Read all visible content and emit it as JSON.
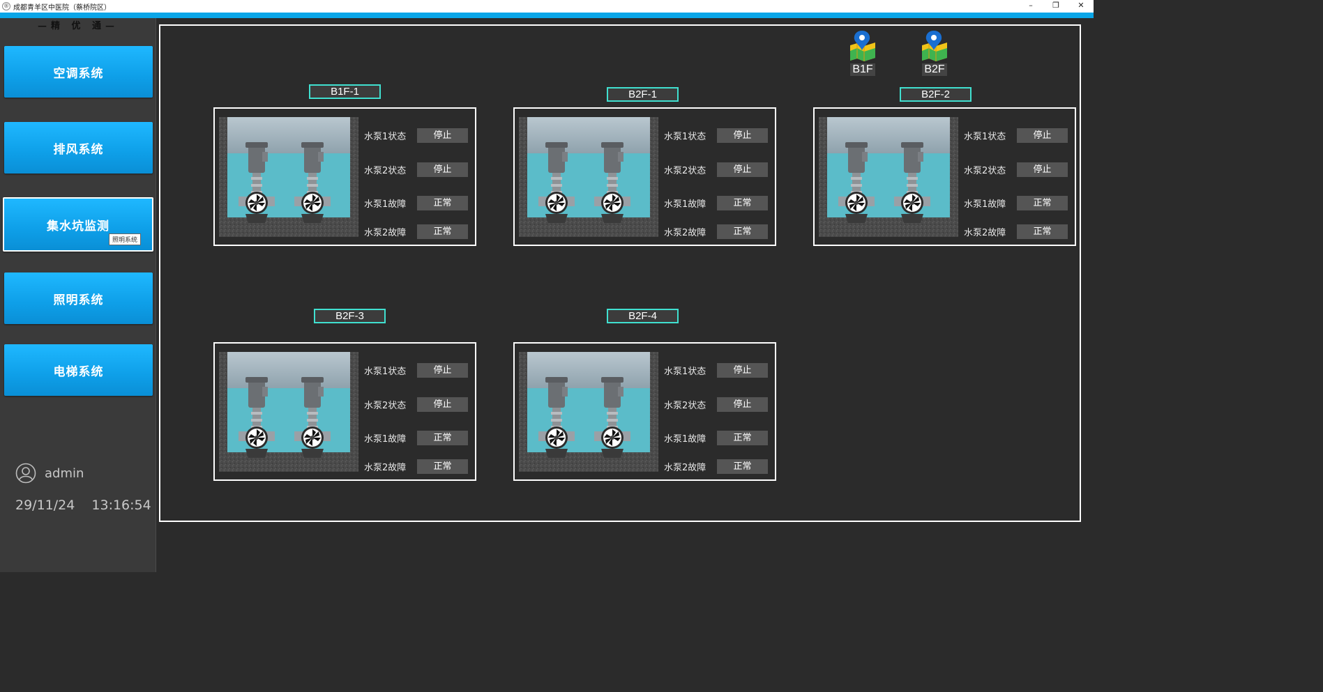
{
  "window": {
    "title": "成都青羊区中医院（蔡桥院区）",
    "icon": "app-icon",
    "controls": [
      "minimize",
      "restore",
      "close"
    ]
  },
  "sidebar": {
    "brand": "—精 优 通—",
    "nav": [
      {
        "label": "空调系统",
        "active": false
      },
      {
        "label": "排风系统",
        "active": false
      },
      {
        "label": "集水坑监测",
        "active": true,
        "tooltip": "照明系统"
      },
      {
        "label": "照明系统",
        "active": false
      },
      {
        "label": "电梯系统",
        "active": false
      }
    ],
    "user": "admin",
    "date": "29/11/24",
    "time": "13:16:54"
  },
  "floors": [
    {
      "label": "B1F",
      "icon": "map-pin-icon"
    },
    {
      "label": "B2F",
      "icon": "map-pin-icon"
    }
  ],
  "units": [
    {
      "name": "B1F-1",
      "rows": [
        {
          "label": "水泵1状态",
          "value": "停止"
        },
        {
          "label": "水泵2状态",
          "value": "停止"
        },
        {
          "label": "水泵1故障",
          "value": "正常"
        },
        {
          "label": "水泵2故障",
          "value": "正常"
        }
      ]
    },
    {
      "name": "B2F-1",
      "rows": [
        {
          "label": "水泵1状态",
          "value": "停止"
        },
        {
          "label": "水泵2状态",
          "value": "停止"
        },
        {
          "label": "水泵1故障",
          "value": "正常"
        },
        {
          "label": "水泵2故障",
          "value": "正常"
        }
      ]
    },
    {
      "name": "B2F-2",
      "rows": [
        {
          "label": "水泵1状态",
          "value": "停止"
        },
        {
          "label": "水泵2状态",
          "value": "停止"
        },
        {
          "label": "水泵1故障",
          "value": "正常"
        },
        {
          "label": "水泵2故障",
          "value": "正常"
        }
      ]
    },
    {
      "name": "B2F-3",
      "rows": [
        {
          "label": "水泵1状态",
          "value": "停止"
        },
        {
          "label": "水泵2状态",
          "value": "停止"
        },
        {
          "label": "水泵1故障",
          "value": "正常"
        },
        {
          "label": "水泵2故障",
          "value": "正常"
        }
      ]
    },
    {
      "name": "B2F-4",
      "rows": [
        {
          "label": "水泵1状态",
          "value": "停止"
        },
        {
          "label": "水泵2状态",
          "value": "停止"
        },
        {
          "label": "水泵1故障",
          "value": "正常"
        },
        {
          "label": "水泵2故障",
          "value": "正常"
        }
      ]
    }
  ],
  "colors": {
    "accent": "#0aa6e8",
    "label_border": "#40e0d0",
    "water": "#5bbcc9",
    "value_bg": "#555555"
  }
}
